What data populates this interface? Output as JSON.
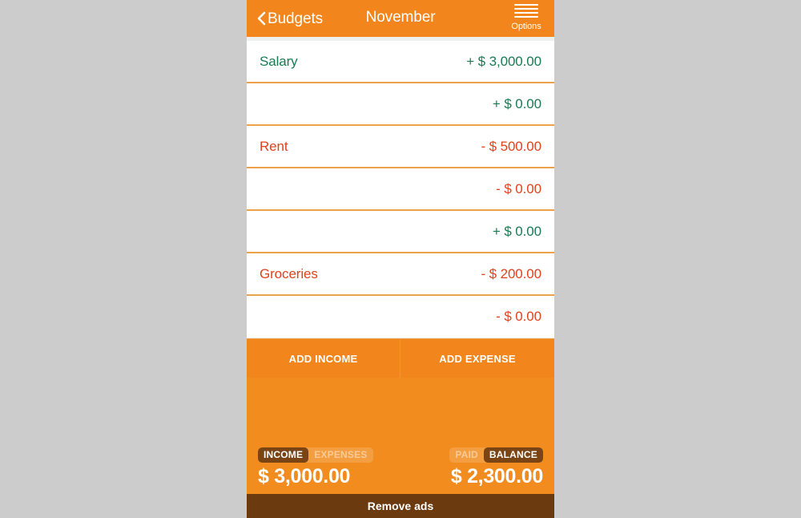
{
  "header": {
    "back_label": "Budgets",
    "title": "November",
    "options_label": "Options",
    "back_icon": "chevron-left-icon",
    "menu_icon": "hamburger-menu-icon"
  },
  "list": {
    "rows": [
      {
        "name": "Salary",
        "amount": "+ $ 3,000.00",
        "type": "income"
      },
      {
        "name": "",
        "amount": "+ $ 0.00",
        "type": "income"
      },
      {
        "name": "Rent",
        "amount": "- $ 500.00",
        "type": "expense"
      },
      {
        "name": "",
        "amount": "- $ 0.00",
        "type": "expense"
      },
      {
        "name": "",
        "amount": "+ $ 0.00",
        "type": "income"
      },
      {
        "name": "Groceries",
        "amount": "- $ 200.00",
        "type": "expense"
      },
      {
        "name": "",
        "amount": "- $ 0.00",
        "type": "expense"
      }
    ]
  },
  "actions": {
    "add_income": "ADD INCOME",
    "add_expense": "ADD EXPENSE"
  },
  "summary": {
    "left": {
      "option_a": "INCOME",
      "option_b": "EXPENSES",
      "selected": "INCOME",
      "amount": "$ 3,000.00"
    },
    "right": {
      "option_a": "PAID",
      "option_b": "BALANCE",
      "selected": "BALANCE",
      "amount": "$ 2,300.00"
    }
  },
  "footer": {
    "remove_ads": "Remove ads"
  },
  "colors": {
    "brand_orange": "#f28c1e",
    "appbar_orange": "#f2851b",
    "income_green": "#1a7a53",
    "expense_red": "#e0421c",
    "divider_orange": "#eca24b",
    "selected_pill_brown": "#7a4414",
    "footer_brown": "#6b3a0f",
    "page_background": "#cccccc"
  }
}
